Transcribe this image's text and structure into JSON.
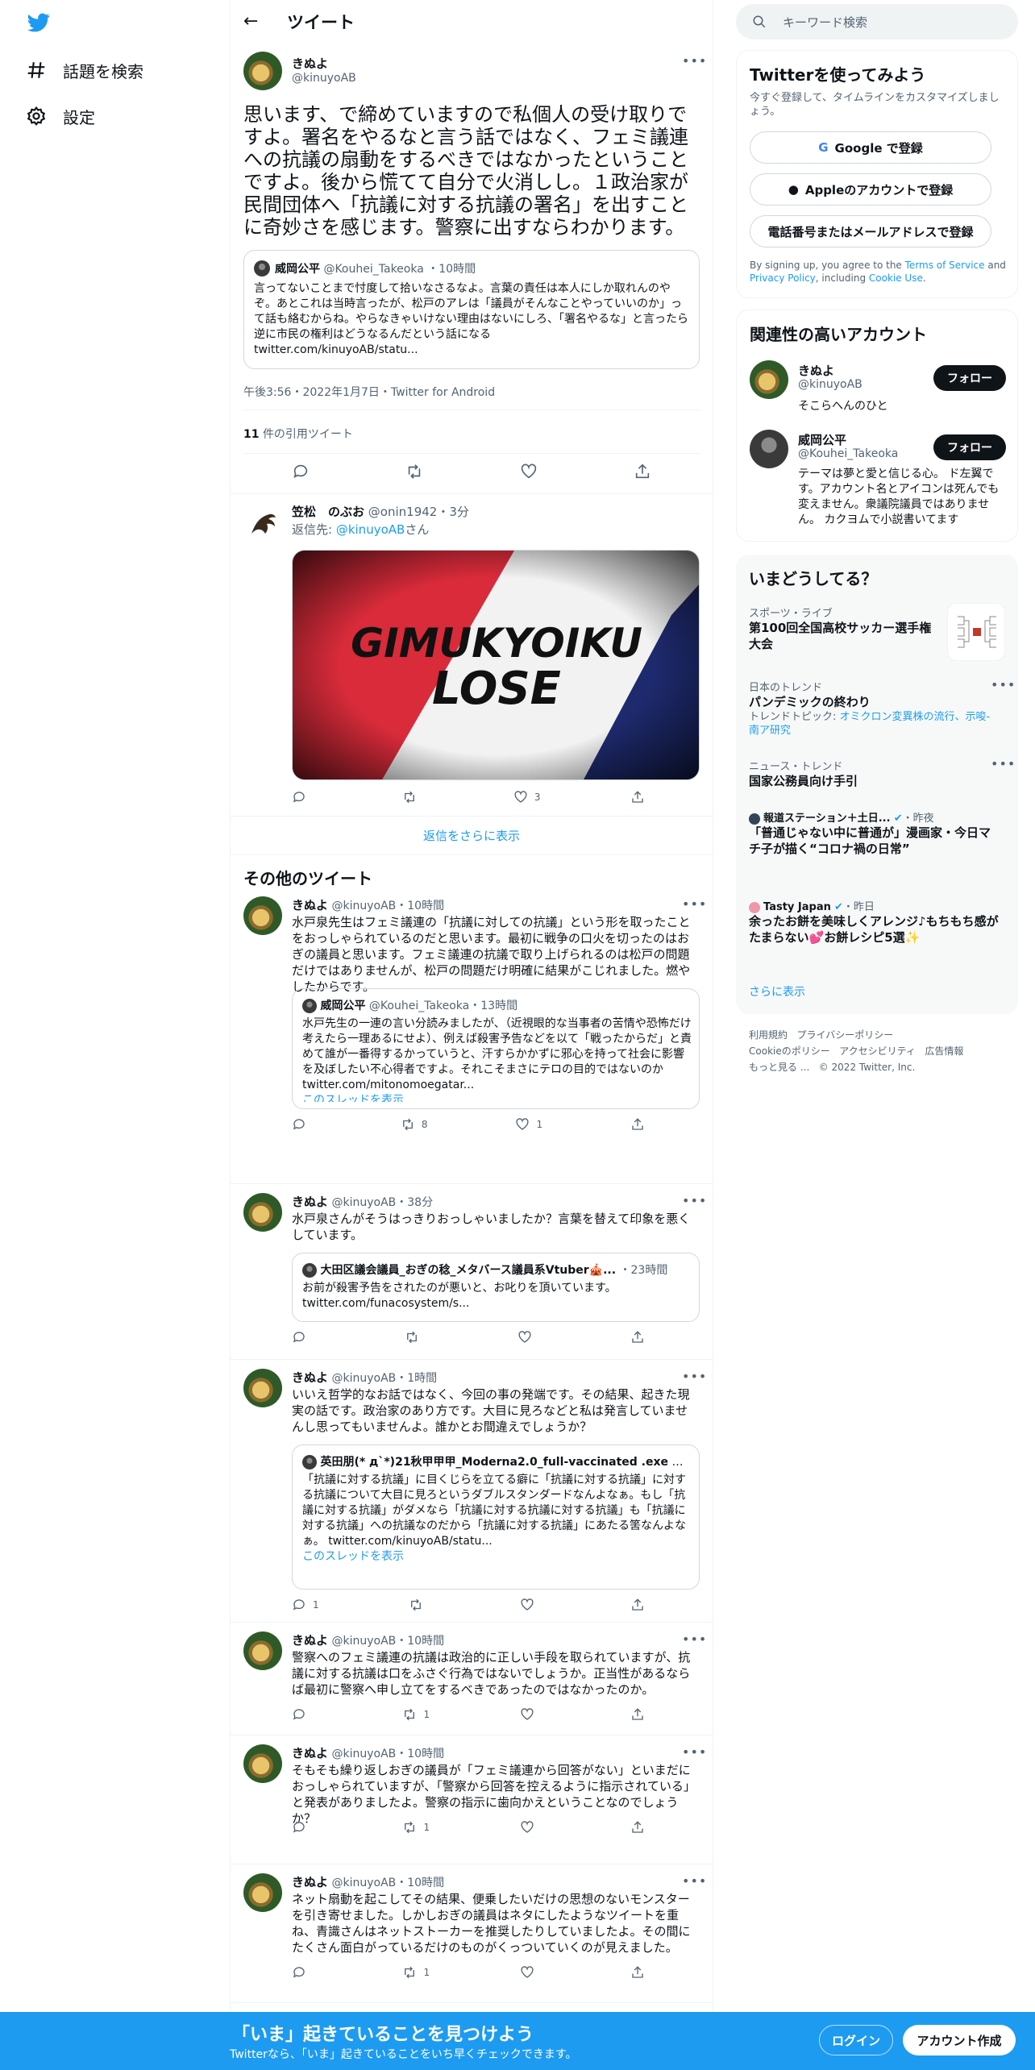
{
  "nav": {
    "explore": "話題を検索",
    "settings": "設定"
  },
  "header": {
    "title": "ツイート"
  },
  "focus_tweet": {
    "name": "きぬよ",
    "handle": "@kinuyoAB",
    "text": "思います、で締めていますので私個人の受け取りですよ。署名をやるなと言う話ではなく、フェミ議連への抗議の扇動をするべきではなかったということですよ。後から慌てて自分で火消しし。１政治家が民間団体へ「抗議に対する抗議の署名」を出すことに奇妙さを感じます。警察に出すならわかります。",
    "quote": {
      "name": "威岡公平",
      "handle": "@Kouhei_Takeoka",
      "time": "10時間",
      "text": "言ってないことまで忖度して拾いなさるなよ。言葉の責任は本人にしか取れんのやぞ。あとこれは当時言ったが、松戸のアレは「議員がそんなことやっていいのか」って話も絡むからね。やらなきゃいけない理由はないにしろ、「署名やるな」と言ったら逆に市民の権利はどうなるんだという話になる",
      "link": "twitter.com/kinuyoAB/statu..."
    },
    "meta": "午後3:56・2022年1月7日・Twitter for Android",
    "quote_count": "11",
    "quote_count_label": "件の引用ツイート"
  },
  "reply": {
    "name": "笠松　のぶお",
    "handle": "@onin1942",
    "time": "3分",
    "reply_to_label": "返信先: ",
    "reply_to": "@kinuyoAB",
    "reply_to_suffix": "さん",
    "image_text_1": "GIMUKYOIKU",
    "image_text_2": "LOSE",
    "likes": "3"
  },
  "show_more_replies": "返信をさらに表示",
  "more_tweets_title": "その他のツイート",
  "tweets": [
    {
      "name": "きぬよ",
      "handle": "@kinuyoAB",
      "time": "10時間",
      "text": "水戸泉先生はフェミ議連の「抗議に対しての抗議」という形を取ったことをおっしゃられているのだと思います。最初に戦争の口火を切ったのはおぎの議員と思います。フェミ議連の抗議で取り上げられるのは松戸の問題だけではありませんが、松戸の問題だけ明確に結果がこじれました。燃やしたからです。",
      "quote_name": "威岡公平",
      "quote_handle": "@Kouhei_Takeoka",
      "quote_time": "13時間",
      "quote_text": "水戸先生の一連の言い分読みましたが、（近視眼的な当事者の苦情や恐怖だけ考えたら一理あるにせよ）、例えば殺害予告などを以て「戦ったからだ」と責めて誰が一番得するかっていうと、汗すらかかずに邪心を持って社会に影響を及ぼしたい不心得者ですよ。それこそまさにテロの目的ではないのか",
      "quote_link": "twitter.com/mitonomoegatar...",
      "thread": "このスレッドを表示",
      "replies": "",
      "retweets": "8",
      "likes": "1"
    },
    {
      "name": "きぬよ",
      "handle": "@kinuyoAB",
      "time": "38分",
      "text": "水戸泉さんがそうはっきりおっしゃいましたか？言葉を替えて印象を悪くしています。",
      "quote_name": "大田区議会議員_おぎの稔_メタバース議員系Vtuber🎪...",
      "quote_time": "23時間",
      "quote_text": "お前が殺害予告をされたのが悪いと、お叱りを頂いています。",
      "quote_link": "twitter.com/funacosystem/s...",
      "replies": "",
      "retweets": "",
      "likes": ""
    },
    {
      "name": "きぬよ",
      "handle": "@kinuyoAB",
      "time": "1時間",
      "text": "いいえ哲学的なお話ではなく、今回の事の発端です。その結果、起きた現実の話です。政治家のあり方です。大目に見ろなどと私は発言していませんし思ってもいませんよ。誰かとお間違えでしょうか？",
      "quote_name": "英田朋(* д`*)21秋甲甲甲_Moderna2.0_full-vaccinated .exe",
      "quote_handle": "@...",
      "quote_time": "3時間",
      "quote_text": "「抗議に対する抗議」に目くじらを立てる癖に「抗議に対する抗議」に対する抗議について大目に見ろというダブルスタンダードなんよなぁ。もし「抗議に対する抗議」がダメなら「抗議に対する抗議に対する抗議」も「抗議に対する抗議」への抗議なのだから「抗議に対する抗議」にあたる筈なんよなぁ。",
      "quote_link": "twitter.com/kinuyoAB/statu...",
      "thread": "このスレッドを表示",
      "replies": "1",
      "retweets": "",
      "likes": ""
    },
    {
      "name": "きぬよ",
      "handle": "@kinuyoAB",
      "time": "10時間",
      "text": "警察へのフェミ議連の抗議は政治的に正しい手段を取られていますが、抗議に対する抗議は口をふさぐ行為ではないでしょうか。正当性があるならば最初に警察へ申し立てをするべきであったのではなかったのか。",
      "replies": "",
      "retweets": "1",
      "likes": ""
    },
    {
      "name": "きぬよ",
      "handle": "@kinuyoAB",
      "time": "10時間",
      "text": "そもそも繰り返しおぎの議員が「フェミ議連から回答がない」といまだにおっしゃられていますが、「警察から回答を控えるように指示されている」と発表がありましたよ。警察の指示に歯向かえということなのでしょうか？",
      "replies": "",
      "retweets": "1",
      "likes": ""
    },
    {
      "name": "きぬよ",
      "handle": "@kinuyoAB",
      "time": "10時間",
      "text": "ネット扇動を起こしてその結果、便乗したいだけの思想のないモンスターを引き寄せました。しかしおぎの議員はネタにしたようなツイートを重ね、青識さんはネットストーカーを推奨したりしていましたよ。その間にたくさん面白がっているだけのものがくっついていくのが見えました。",
      "replies": "",
      "retweets": "1",
      "likes": ""
    }
  ],
  "right": {
    "search_placeholder": "キーワード検索",
    "signup_title": "Twitterを使ってみよう",
    "signup_sub": "今すぐ登録して、タイムラインをカスタマイズしましょう。",
    "google_btn": "Google で登録",
    "apple_btn": "Appleのアカウントで登録",
    "phone_btn": "電話番号またはメールアドレスで登録",
    "terms_1": "By signing up, you agree to the ",
    "terms_tos": "Terms of Service",
    "terms_and": " and ",
    "terms_privacy": "Privacy Policy",
    "terms_2": ", including ",
    "terms_cookie": "Cookie Use",
    "terms_end": ".",
    "related_title": "関連性の高いアカウント",
    "accounts": [
      {
        "name": "きぬよ",
        "handle": "@kinuyoAB",
        "bio": "そこらへんのひと",
        "follow": "フォロー"
      },
      {
        "name": "威岡公平",
        "handle": "@Kouhei_Takeoka",
        "bio": "テーマは夢と愛と信じる心。 ド左翼です。アカウント名とアイコンは死んでも変えません。衆議院議員ではありません。 カクヨムで小説書いてます",
        "follow": "フォロー"
      }
    ],
    "trends_title": "いまどうしてる？",
    "trends": [
      {
        "context": "スポーツ・ライブ",
        "title": "第100回全国高校サッカー選手権大会"
      },
      {
        "context": "日本のトレンド",
        "title": "パンデミックの終わり",
        "sub_label": "トレンドトピック: ",
        "sub_links": "オミクロン変異株の流行、示唆-南ア研究"
      },
      {
        "context": "ニュース・トレンド",
        "title": "国家公務員向け手引"
      },
      {
        "context": "報道ステーション＋土日...",
        "time": "・昨夜",
        "title": "「普通じゃない中に普通が」漫画家・今日マチ子が描く“コロナ禍の日常”"
      },
      {
        "context": "Tasty Japan",
        "time": "・昨日",
        "title": "余ったお餅を美味しくアレンジ♪もちもち感がたまらない💕お餅レシピ5選✨"
      }
    ],
    "show_more": "さらに表示",
    "footer": [
      "利用規約",
      "プライバシーポリシー",
      "Cookieのポリシー",
      "アクセシビリティ",
      "広告情報",
      "もっと見る ...",
      "© 2022 Twitter, Inc."
    ]
  },
  "banner": {
    "title": "「いま」起きていることを見つけよう",
    "sub": "Twitterなら、「いま」起きていることをいち早くチェックできます。",
    "login": "ログイン",
    "signup": "アカウント作成"
  },
  "colors": {
    "accent": "#1d9bf0",
    "text": "#0f1419",
    "muted": "#536471",
    "like": "#f91880"
  }
}
